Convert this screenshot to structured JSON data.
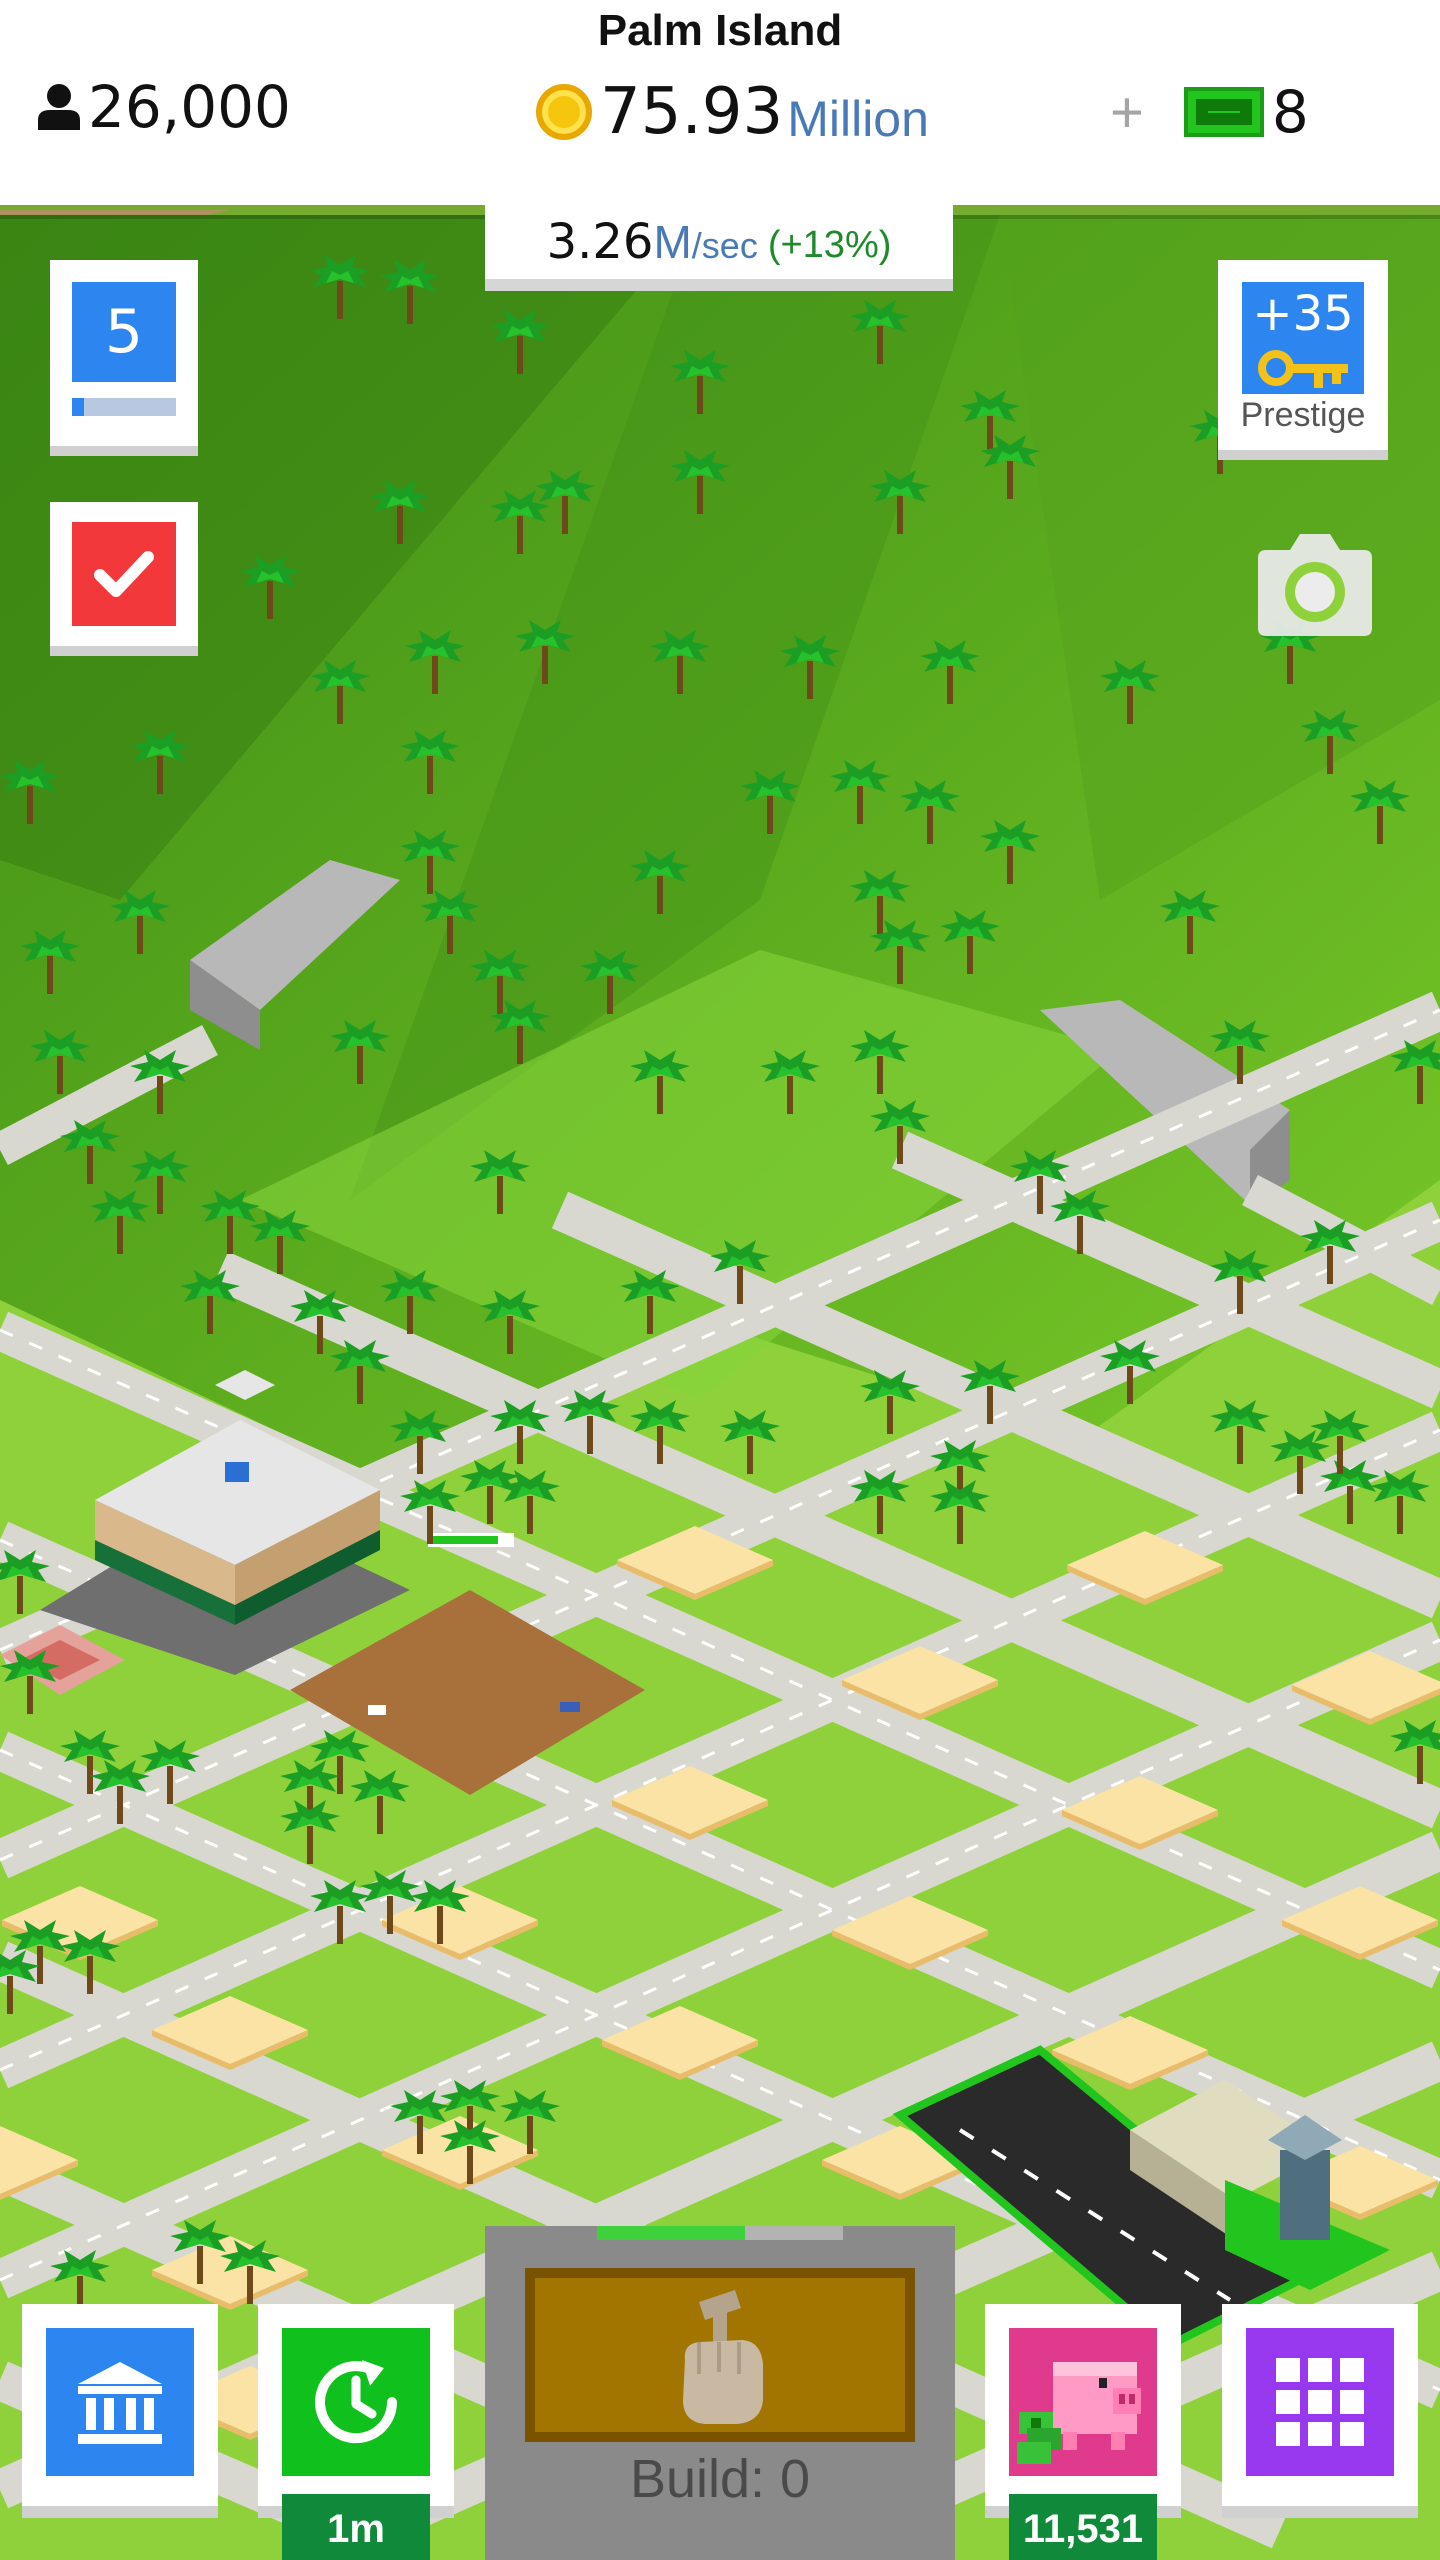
{
  "header": {
    "island_name": "Palm Island",
    "population": "26,000",
    "money_amount": "75.93",
    "money_unit": "Million",
    "cash_plus": "+",
    "cash_amount": "8"
  },
  "income": {
    "value": "3.26",
    "unit": "M",
    "per": "/sec",
    "bonus": "(+13%)"
  },
  "level": {
    "number": "5",
    "progress": 0.12
  },
  "prestige": {
    "keys": "+35",
    "label": "Prestige"
  },
  "bottom_bar": {
    "offline_badge": "1m",
    "build_label": "Build: 0",
    "build_progress": 0.6,
    "piggy_badge": "11,531"
  },
  "map": {
    "building_progress": 0.8
  },
  "icons": {
    "population": "person-icon",
    "money": "coin-icon",
    "cash": "cash-icon",
    "tasks": "checkmark-icon",
    "prestige": "key-icon",
    "camera": "camera-icon",
    "bank": "bank-icon",
    "offline": "clock-refresh-icon",
    "build": "hammer-hand-icon",
    "piggy": "piggy-bank-icon",
    "menu": "grid-icon"
  },
  "colors": {
    "accent_blue": "#2d86f0",
    "task_red": "#f2383a",
    "offline_green": "#10c01c",
    "piggy_pink": "#e03a8c",
    "menu_purple": "#9838ef",
    "unit_blue": "#4a7ab5",
    "bonus_green": "#1e8a2a",
    "grass": "#8fd13a"
  }
}
